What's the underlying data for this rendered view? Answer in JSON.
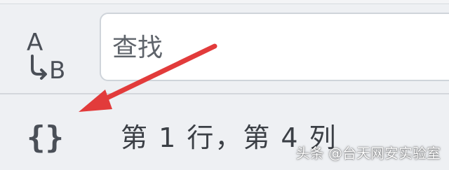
{
  "find": {
    "match_case_icon": "match-case-icon",
    "placeholder": "查找"
  },
  "status": {
    "braces_icon": "braces-icon",
    "braces_glyph": "{}",
    "cursor_position": "第 1 行，第 4 列"
  },
  "annotation": {
    "arrow_color": "#e23b3b"
  },
  "watermark": {
    "text": "头条 @台天网安实验室"
  }
}
